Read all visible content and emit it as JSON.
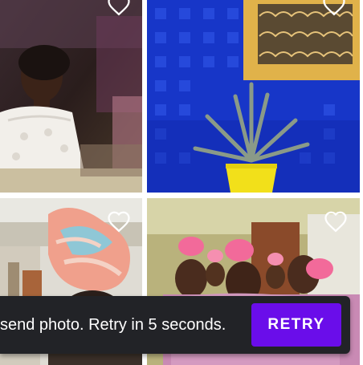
{
  "photos": [
    {
      "name": "Bride in white lace dress",
      "favorite": false
    },
    {
      "name": "Aloe plant on blue wall",
      "favorite": false
    },
    {
      "name": "Colorful fabric bundle",
      "favorite": false
    },
    {
      "name": "Women in pink hats",
      "favorite": false
    }
  ],
  "icons": {
    "favorite": "heart-outline-icon"
  },
  "snackbar": {
    "message": "send photo. Retry in 5 seconds.",
    "action_label": "RETRY"
  },
  "colors": {
    "snackbar_bg": "#222327",
    "action_accent": "#6a0dea",
    "heart": "#ffffff"
  }
}
